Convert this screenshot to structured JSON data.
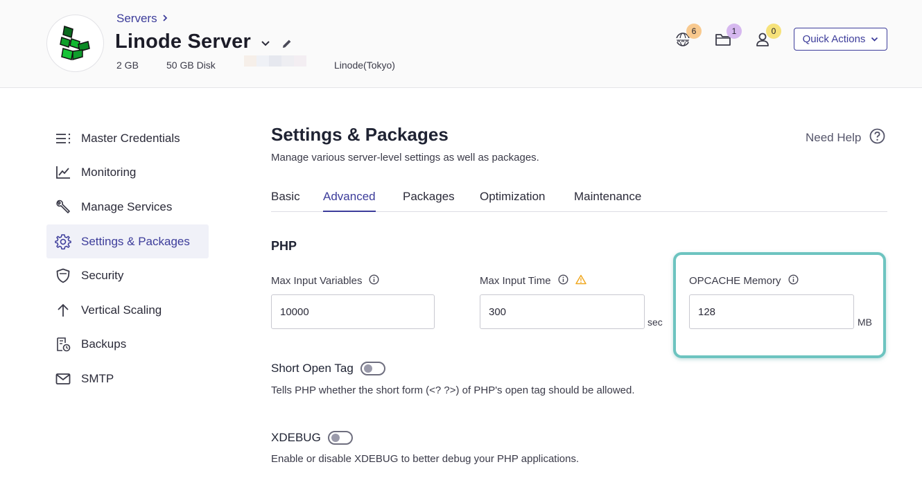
{
  "header": {
    "breadcrumb": "Servers",
    "server_name": "Linode Server",
    "ram": "2 GB",
    "disk": "50 GB Disk",
    "location": "Linode(Tokyo)",
    "badges": {
      "www": "6",
      "files": "1",
      "users": "0"
    },
    "quick_actions_label": "Quick Actions"
  },
  "sidebar": {
    "items": [
      {
        "label": "Master Credentials",
        "icon": "list-icon"
      },
      {
        "label": "Monitoring",
        "icon": "chart-line-icon"
      },
      {
        "label": "Manage Services",
        "icon": "wrench-icon"
      },
      {
        "label": "Settings & Packages",
        "icon": "gear-icon",
        "active": true
      },
      {
        "label": "Security",
        "icon": "shield-icon"
      },
      {
        "label": "Vertical Scaling",
        "icon": "arrow-up-icon"
      },
      {
        "label": "Backups",
        "icon": "backup-icon"
      },
      {
        "label": "SMTP",
        "icon": "mail-icon"
      }
    ]
  },
  "main": {
    "title": "Settings & Packages",
    "subtitle": "Manage various server-level settings as well as packages.",
    "need_help": "Need Help",
    "tabs": [
      "Basic",
      "Advanced",
      "Packages",
      "Optimization",
      "Maintenance"
    ],
    "active_tab": "Advanced",
    "section_title": "PHP",
    "fields": {
      "max_input_vars": {
        "label": "Max Input Variables",
        "value": "10000"
      },
      "max_input_time": {
        "label": "Max Input Time",
        "value": "300",
        "unit": "sec"
      },
      "opcache_memory": {
        "label": "OPCACHE Memory",
        "value": "128",
        "unit": "MB"
      }
    },
    "short_open_tag": {
      "label": "Short Open Tag",
      "description": "Tells PHP whether the short form (<? ?>) of PHP's open tag should be allowed.",
      "enabled": false
    },
    "xdebug": {
      "label": "XDEBUG",
      "description": "Enable or disable XDEBUG to better debug your PHP applications.",
      "enabled": false
    }
  },
  "colors": {
    "accent": "#3c3c9a",
    "highlight": "#6dc4c0",
    "badge_www": "#f8c98e",
    "badge_files": "#d6b8ef",
    "badge_users": "#f6e27a"
  }
}
